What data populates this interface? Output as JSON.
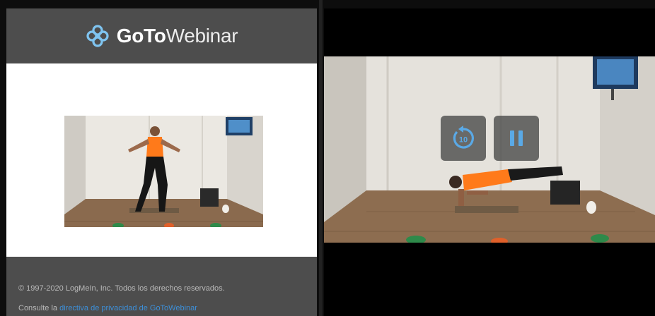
{
  "brand": {
    "name_bold": "GoTo",
    "name_light": "Webinar",
    "icon": "gotowebinar-flower-icon",
    "header_color": "#4d4d4d"
  },
  "footer": {
    "copyright": "© 1997-2020 LogMeIn, Inc. Todos los derechos reservados.",
    "privacy_prefix": "Consulte la ",
    "privacy_link": "directiva de privacidad de GoToWebinar",
    "link_color": "#3d8fd8"
  },
  "player": {
    "rewind_icon": "rewind-10-icon",
    "rewind_seconds": "10",
    "pause_icon": "pause-icon",
    "accent_color": "#5aa9e6"
  }
}
